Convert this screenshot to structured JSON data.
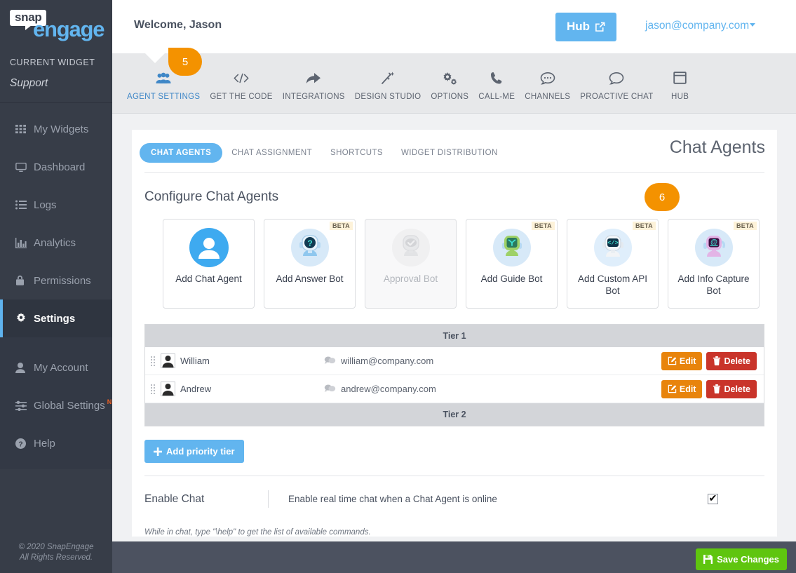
{
  "sidebar": {
    "logo": {
      "part1": "snap",
      "part2": "engage"
    },
    "widget_section_label": "CURRENT WIDGET",
    "widget_name": "Support",
    "primary_items": [
      {
        "label": "My Widgets",
        "icon": "grid-icon"
      },
      {
        "label": "Dashboard",
        "icon": "monitor-icon"
      },
      {
        "label": "Logs",
        "icon": "list-icon"
      },
      {
        "label": "Analytics",
        "icon": "bar-chart-icon"
      },
      {
        "label": "Permissions",
        "icon": "lock-icon"
      },
      {
        "label": "Settings",
        "icon": "gear-icon"
      }
    ],
    "secondary_items": [
      {
        "label": "My Account",
        "icon": "user-icon",
        "badge": ""
      },
      {
        "label": "Global Settings",
        "icon": "sliders-icon",
        "badge": "N"
      },
      {
        "label": "Help",
        "icon": "question-circle-icon",
        "badge": ""
      }
    ],
    "footer_line1": "© 2020 SnapEngage",
    "footer_line2": "All Rights Reserved."
  },
  "header": {
    "welcome": "Welcome, Jason",
    "hub_button": "Hub",
    "hub_icon": "external-link-icon",
    "user_email": "jason@company.com"
  },
  "topnav": {
    "items": [
      {
        "label": "AGENT SETTINGS",
        "icon": "users-icon",
        "active": true
      },
      {
        "label": "GET THE CODE",
        "icon": "code-icon",
        "active": false
      },
      {
        "label": "INTEGRATIONS",
        "icon": "share-arrow-icon",
        "active": false
      },
      {
        "label": "DESIGN STUDIO",
        "icon": "magic-wand-icon",
        "active": false
      },
      {
        "label": "OPTIONS",
        "icon": "gears-icon",
        "active": false
      },
      {
        "label": "CALL-ME",
        "icon": "phone-icon",
        "active": false
      },
      {
        "label": "CHANNELS",
        "icon": "chat-dots-icon",
        "active": false
      },
      {
        "label": "PROACTIVE CHAT",
        "icon": "chat-bubble-icon",
        "active": false
      },
      {
        "label": "HUB",
        "icon": "window-icon",
        "active": false
      }
    ]
  },
  "badges": {
    "step5": "5",
    "step6": "6"
  },
  "tabs": [
    {
      "label": "CHAT AGENTS",
      "active": true
    },
    {
      "label": "CHAT ASSIGNMENT",
      "active": false
    },
    {
      "label": "SHORTCUTS",
      "active": false
    },
    {
      "label": "WIDGET DISTRIBUTION",
      "active": false
    }
  ],
  "page": {
    "title": "Chat Agents",
    "section_title": "Configure Chat Agents"
  },
  "bot_cards": [
    {
      "label": "Add Chat Agent",
      "beta": "",
      "disabled": false,
      "icon": "person-avatar-icon"
    },
    {
      "label": "Add Answer Bot",
      "beta": "BETA",
      "disabled": false,
      "icon": "answer-bot-icon"
    },
    {
      "label": "Approval Bot",
      "beta": "",
      "disabled": true,
      "icon": "approval-bot-icon"
    },
    {
      "label": "Add Guide Bot",
      "beta": "BETA",
      "disabled": false,
      "icon": "guide-bot-icon"
    },
    {
      "label": "Add Custom API Bot",
      "beta": "BETA",
      "disabled": false,
      "icon": "custom-api-bot-icon"
    },
    {
      "label": "Add Info Capture Bot",
      "beta": "BETA",
      "disabled": false,
      "icon": "info-capture-bot-icon"
    }
  ],
  "tiers": [
    {
      "title": "Tier 1",
      "agents": [
        {
          "name": "William",
          "email": "william@company.com",
          "edit_label": "Edit",
          "delete_label": "Delete"
        },
        {
          "name": "Andrew",
          "email": "andrew@company.com",
          "edit_label": "Edit",
          "delete_label": "Delete"
        }
      ]
    },
    {
      "title": "Tier 2",
      "agents": []
    }
  ],
  "actions": {
    "add_priority_tier": "Add priority tier",
    "save_changes": "Save Changes"
  },
  "enable_chat": {
    "label": "Enable Chat",
    "description": "Enable real time chat when a Chat Agent is online",
    "checked": true,
    "checkmark": "✔"
  },
  "footnote": "While in chat, type \"\\help\" to get the list of available commands.",
  "colors": {
    "sidebar_bg": "#373d48",
    "accent_blue": "#62b5ef",
    "badge_orange": "#f49200",
    "edit_orange": "#e8840c",
    "delete_red": "#c9342a",
    "save_green": "#5fc50f",
    "bottom_bar": "#4c5260"
  }
}
